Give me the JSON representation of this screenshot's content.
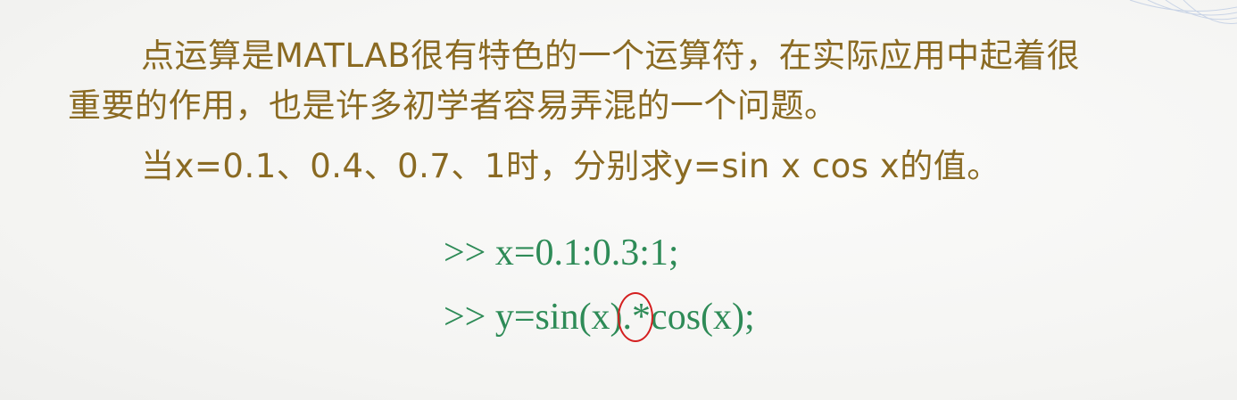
{
  "paragraphs": {
    "line1": "点运算是MATLAB很有特色的一个运算符，在实际应用中起着很",
    "line2": "重要的作用，也是许多初学者容易弄混的一个问题。",
    "line3": "当x=0.1、0.4、0.7、1时，分别求y=sin x cos x的值。"
  },
  "code": {
    "line1": ">> x=0.1:0.3:1;",
    "line2_prefix": ">> y=sin(x)",
    "line2_operator": ".*",
    "line2_suffix": "cos(x);"
  },
  "colors": {
    "text": "#8a6a22",
    "code": "#2e8b57",
    "highlight_circle": "#d42020"
  }
}
